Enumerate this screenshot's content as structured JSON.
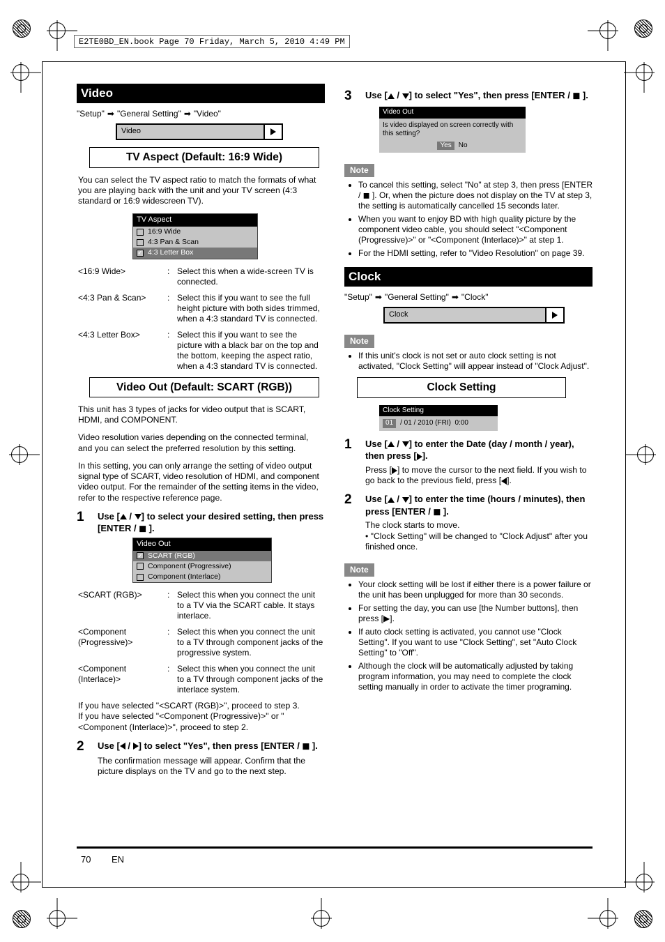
{
  "file_header": "E2TE0BD_EN.book  Page 70  Friday, March 5, 2010  4:49 PM",
  "page_number": "70",
  "page_label": "EN",
  "left": {
    "section_title": "Video",
    "path_prefix": "\"Setup\"",
    "path_mid": "\"General Setting\"",
    "path_end": "\"Video\"",
    "nav_label": "Video",
    "heading_tv_aspect": "TV Aspect (Default: 16:9 Wide)",
    "tv_aspect_body": "You can select the TV aspect ratio to match the formats of what you are playing back with the unit and your TV screen (4:3 standard or 16:9 widescreen TV).",
    "tv_aspect_options_title": "TV Aspect",
    "tv_aspect_options": [
      {
        "label": "16:9 Wide",
        "checked": false
      },
      {
        "label": "4:3 Pan & Scan",
        "checked": false
      },
      {
        "label": "4:3 Letter Box",
        "checked": true,
        "selected": true
      }
    ],
    "desc_rows": [
      {
        "name": "<16:9 Wide>",
        "desc": "Select this when a wide-screen TV is connected."
      },
      {
        "name": "<4:3 Pan & Scan>",
        "desc": "Select this if you want to see the full height picture with both sides trimmed, when a 4:3 standard TV is connected."
      },
      {
        "name": "<4:3 Letter Box>",
        "desc": "Select this if you want to see the picture with a black bar on the top and the bottom, keeping the aspect ratio, when a 4:3 standard TV is connected."
      }
    ],
    "heading_video_out": "Video Out (Default: SCART (RGB))",
    "video_out_body1": "This unit has 3 types of jacks for video output that is SCART, HDMI, and COMPONENT.",
    "video_out_body2": "Video resolution varies depending on the connected terminal, and you can select the preferred resolution by this setting.",
    "video_out_body3": "In this setting, you can only arrange the setting of video output signal type of SCART, video resolution of HDMI, and component video output. For the remainder of the setting items in the video, refer to the respective reference page.",
    "step1_text_a": "Use [ / ] to select your desired setting, then press [ENTER / ].",
    "vo_options_title": "Video Out",
    "vo_options": [
      {
        "label": "SCART (RGB)",
        "checked": true,
        "selected": true
      },
      {
        "label": "Component (Progressive)",
        "checked": false
      },
      {
        "label": "Component (Interlace)",
        "checked": false
      }
    ],
    "vo_desc_rows": [
      {
        "name": "<SCART (RGB)>",
        "desc": "Select this when you connect the unit to a TV via the SCART cable. It stays interlace."
      },
      {
        "name": "<Component (Progressive)>",
        "desc": "Select this when you connect the unit to a TV through component jacks of the progressive system."
      },
      {
        "name": "<Component (Interlace)>",
        "desc": "Select this when you connect the unit to a TV through component jacks of the interlace system."
      }
    ],
    "vo_note": "If you have selected \"<SCART (RGB)>\", proceed to step 3.\nIf you have selected \"<Component (Progressive)>\" or \"<Component (Interlace)>\", proceed to step 2.",
    "step2_text": "Use [◀ / ▶] to select \"Yes\", then press [ENTER / ].",
    "step2_after": "The confirmation message will appear. Confirm that the picture displays on the TV and go to the next step."
  },
  "right": {
    "step3_text_a": "Use [ / ] to select \"Yes\", then press [ENTER / ].",
    "mini_bar": "Video Out",
    "mini_body_line1": "Is video displayed on screen correctly with this setting?",
    "mini_yes": "Yes",
    "mini_no": "No",
    "s3_note_title": "Note",
    "s3_notes": [
      "To cancel this setting, select \"No\" at step 3, then press [ENTER / ◼ ]. Or, when the picture does not display on the TV at step 3, the setting is automatically cancelled 15 seconds later.",
      "When you want to enjoy BD with high quality picture by the component video cable, you should select \"<Component (Progressive)>\" or \"<Component (Interlace)>\" at step 1.",
      "For the HDMI setting, refer to \"Video Resolution\" on page 39."
    ],
    "section_title": "Clock",
    "path_prefix": "\"Setup\"",
    "path_mid": "\"General Setting\"",
    "path_end": "\"Clock\"",
    "nav_label": "Clock",
    "s_note_title": "Note",
    "s_notes": [
      "If this unit's clock is not set or auto clock setting is not activated, \"Clock Setting\" will appear instead of \"Clock Adjust\"."
    ],
    "heading_clock": "Clock Setting",
    "clock_mini_bar": "Clock Setting",
    "clock_mini_line": "01 / 01 / 2010 (FRI)      0:00",
    "clock_step1": "Use [ / ] to enter the Date (day / month / year), then press [▶].",
    "clock_step1_after": "Press [▶] to move the cursor to the next field. If you wish to go back to the previous field, press [◀].",
    "clock_step2": "Use [ / ] to enter the time (hours / minutes), then press [ENTER / ].",
    "clock_step2_after": "The clock starts to move.\n• \"Clock Setting\" will be changed to \"Clock Adjust\" after you finished once.",
    "final_note_title": "Note",
    "final_notes": [
      "Your clock setting will be lost if either there is a power failure or the unit has been unplugged for more than 30 seconds.",
      "For setting the day, you can use [the Number buttons], then press [▶].",
      "If auto clock setting is activated, you cannot use \"Clock Setting\". If you want to use \"Clock Setting\", set \"Auto Clock Setting\" to \"Off\".",
      "Although the clock will be automatically adjusted by taking program information, you may need to complete the clock setting manually in order to activate the timer programing."
    ]
  }
}
